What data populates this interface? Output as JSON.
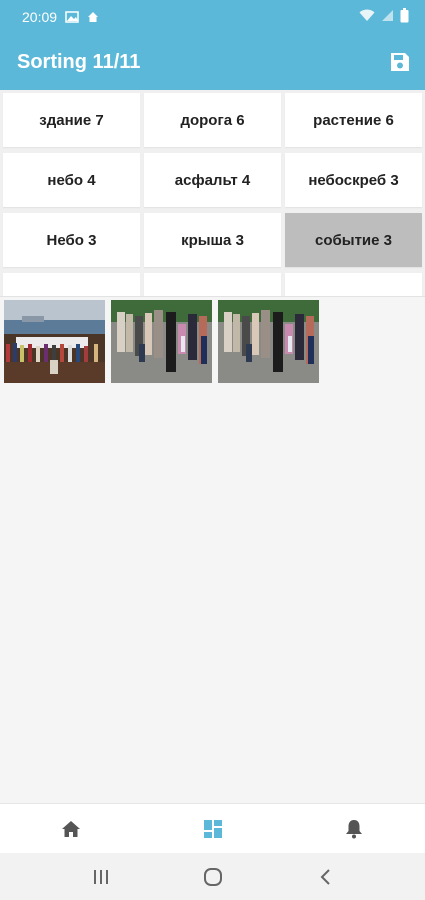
{
  "status_bar": {
    "time": "20:09",
    "icons": [
      "image-icon",
      "home-small-icon",
      "wifi-icon",
      "signal-icon",
      "battery-icon"
    ]
  },
  "app_bar": {
    "title": "Sorting 11/11",
    "action_icon": "save-icon"
  },
  "tags": [
    {
      "label": "здание 7",
      "selected": false
    },
    {
      "label": "дорога 6",
      "selected": false
    },
    {
      "label": "растение 6",
      "selected": false
    },
    {
      "label": "небо 4",
      "selected": false
    },
    {
      "label": "асфальт 4",
      "selected": false
    },
    {
      "label": "небоскреб 3",
      "selected": false
    },
    {
      "label": "Небо 3",
      "selected": false
    },
    {
      "label": "крыша 3",
      "selected": false
    },
    {
      "label": "событие 3",
      "selected": true
    },
    {
      "label": "",
      "selected": false
    },
    {
      "label": "",
      "selected": false
    },
    {
      "label": "",
      "selected": false
    }
  ],
  "photos": [
    {
      "subject": "crowd-by-sea-banner"
    },
    {
      "subject": "people-on-street"
    },
    {
      "subject": "people-on-street"
    }
  ],
  "bottom_nav": [
    {
      "icon": "home-icon",
      "active": false
    },
    {
      "icon": "dashboard-icon",
      "active": true
    },
    {
      "icon": "bell-icon",
      "active": false
    }
  ],
  "system_nav": [
    "recent-apps-icon",
    "home-circle-icon",
    "back-icon"
  ],
  "colors": {
    "primary": "#5cb8d8",
    "selected_tag": "#bdbdbd",
    "icon_inactive": "#555555"
  }
}
